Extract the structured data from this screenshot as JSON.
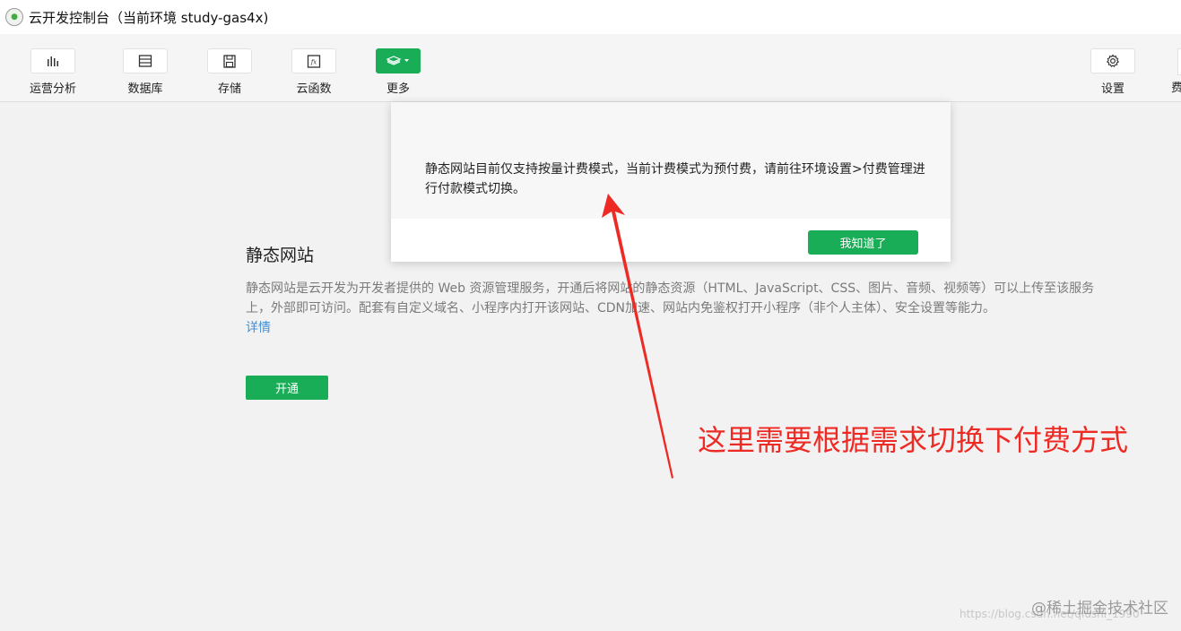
{
  "window": {
    "title": "云开发控制台（当前环境 study-gas4x)"
  },
  "toolbar": {
    "items": [
      {
        "label": "运营分析",
        "icon": "bar-chart-icon"
      },
      {
        "label": "数据库",
        "icon": "database-icon"
      },
      {
        "label": "存储",
        "icon": "save-icon"
      },
      {
        "label": "云函数",
        "icon": "function-icon"
      },
      {
        "label": "更多",
        "icon": "layers-icon"
      }
    ],
    "settings_label": "设置",
    "right_edge_fragment": "费"
  },
  "dialog": {
    "message": "静态网站目前仅支持按量计费模式，当前计费模式为预付费，请前往环境设置>付费管理进行付款模式切换。",
    "ok_label": "我知道了"
  },
  "main": {
    "title": "静态网站",
    "description": "静态网站是云开发为开发者提供的 Web 资源管理服务，开通后将网站的静态资源（HTML、JavaScript、CSS、图片、音频、视频等）可以上传至该服务上，外部即可访问。配套有自定义域名、小程序内打开该网站、CDN加速、网站内免鉴权打开小程序（非个人主体）、安全设置等能力。",
    "details_link": "详情",
    "open_button": "开通"
  },
  "annotation": {
    "text": "这里需要根据需求切换下付费方式",
    "color": "#ee2a24"
  },
  "watermark": {
    "text": "@稀土掘金技术社区",
    "url": "https://blog.csdn.net/qiushi_1990"
  },
  "colors": {
    "primary_green": "#1aad57",
    "link_blue": "#3e90d8"
  }
}
